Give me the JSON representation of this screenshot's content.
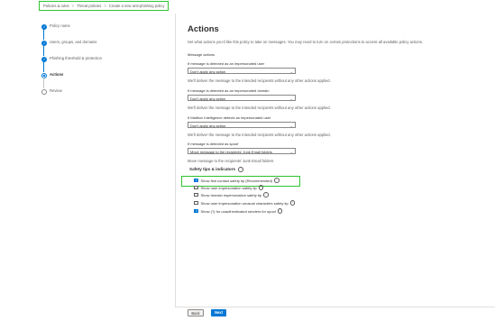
{
  "breadcrumb": [
    "Policies & rules",
    "Threat policies",
    "Create a new anti-phishing policy"
  ],
  "steps": [
    {
      "label": "Policy name",
      "state": "done"
    },
    {
      "label": "Users, groups, and domains",
      "state": "done"
    },
    {
      "label": "Phishing threshold & protection",
      "state": "done"
    },
    {
      "label": "Actions",
      "state": "current"
    },
    {
      "label": "Review",
      "state": "pending"
    }
  ],
  "page": {
    "title": "Actions",
    "description": "Set what actions you'd like this policy to take on messages. You may need to turn on certain protections to access all available policy actions.",
    "message_actions_label": "Message actions"
  },
  "fields": [
    {
      "label": "If message is detected as an impersonated user",
      "value": "Don't apply any action",
      "note": "We'll deliver the message to the intended recipients without any other actions applied."
    },
    {
      "label": "If message is detected as an impersonated domain",
      "value": "Don't apply any action",
      "note": "We'll deliver the message to the intended recipients without any other actions applied."
    },
    {
      "label": "If Mailbox Intelligence detects an impersonated user",
      "value": "Don't apply any action",
      "note": "We'll deliver the message to the intended recipients without any other actions applied."
    },
    {
      "label": "If message is detected as spoof",
      "value": "Move message to the recipients' Junk Email folders",
      "note": "Move message to the recipients' Junk Email folders"
    }
  ],
  "safety_tips": {
    "header": "Safety tips & indicators",
    "info_glyph": "i",
    "items": [
      {
        "label": "Show first contact safety tip (Recommended)",
        "checked": true,
        "info": true
      },
      {
        "label": "Show user impersonation safety tip",
        "checked": false,
        "info": true
      },
      {
        "label": "Show domain impersonation safety tip",
        "checked": false,
        "info": true
      },
      {
        "label": "Show user impersonation unusual characters safety tip",
        "checked": false,
        "info": true
      },
      {
        "label": "Show (?) for unauthenticated senders for spoof",
        "checked": true,
        "info": true
      }
    ]
  },
  "buttons": {
    "back": "Back",
    "next": "Next"
  },
  "icons": {
    "check": "✓",
    "chevron": "⌄"
  },
  "colors": {
    "accent": "#0078d4",
    "highlight": "#2fc42f"
  }
}
